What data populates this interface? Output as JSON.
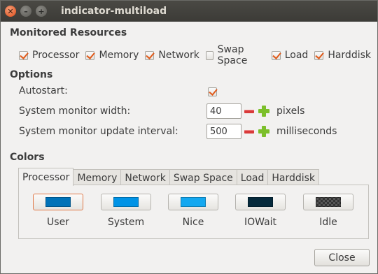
{
  "window": {
    "title": "indicator-multiload"
  },
  "monitored": {
    "heading": "Monitored Resources",
    "items": [
      {
        "label": "Processor",
        "checked": true
      },
      {
        "label": "Memory",
        "checked": true
      },
      {
        "label": "Network",
        "checked": true
      },
      {
        "label": "Swap Space",
        "checked": false
      },
      {
        "label": "Load",
        "checked": true
      },
      {
        "label": "Harddisk",
        "checked": true
      }
    ]
  },
  "options": {
    "heading": "Options",
    "autostart_label": "Autostart:",
    "autostart_checked": true,
    "width_label": "System monitor width:",
    "width_value": "40",
    "width_unit": "pixels",
    "interval_label": "System monitor update interval:",
    "interval_value": "500",
    "interval_unit": "milliseconds"
  },
  "colors": {
    "heading": "Colors",
    "tabs": [
      "Processor",
      "Memory",
      "Network",
      "Swap Space",
      "Load",
      "Harddisk"
    ],
    "active_tab": "Processor",
    "swatches": [
      {
        "label": "User",
        "color": "#0072b8"
      },
      {
        "label": "System",
        "color": "#0093e6"
      },
      {
        "label": "Nice",
        "color": "#14a8f0"
      },
      {
        "label": "IOWait",
        "color": "#062a3c"
      },
      {
        "label": "Idle",
        "color": "checkered"
      }
    ]
  },
  "buttons": {
    "close": "Close"
  }
}
